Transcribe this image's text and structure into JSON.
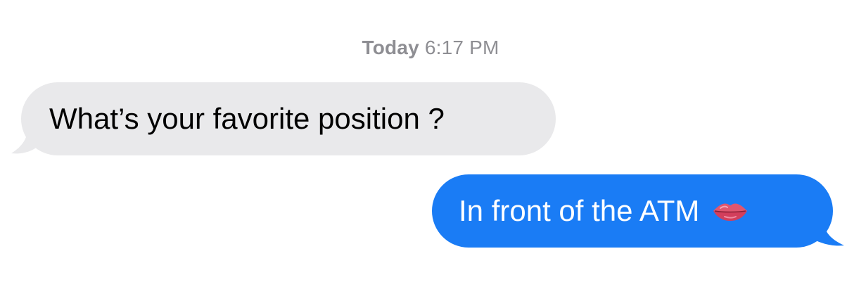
{
  "thread": {
    "timestamp_day": "Today",
    "timestamp_time": "6:17 PM",
    "messages": [
      {
        "direction": "incoming",
        "text": "What’s your favorite position ?",
        "bubble_color": "#e9e9eb",
        "text_color": "#000000"
      },
      {
        "direction": "outgoing",
        "text": "In front of the ATM",
        "emoji": "lips-icon",
        "bubble_color": "#1a7cf5",
        "text_color": "#ffffff"
      }
    ]
  }
}
